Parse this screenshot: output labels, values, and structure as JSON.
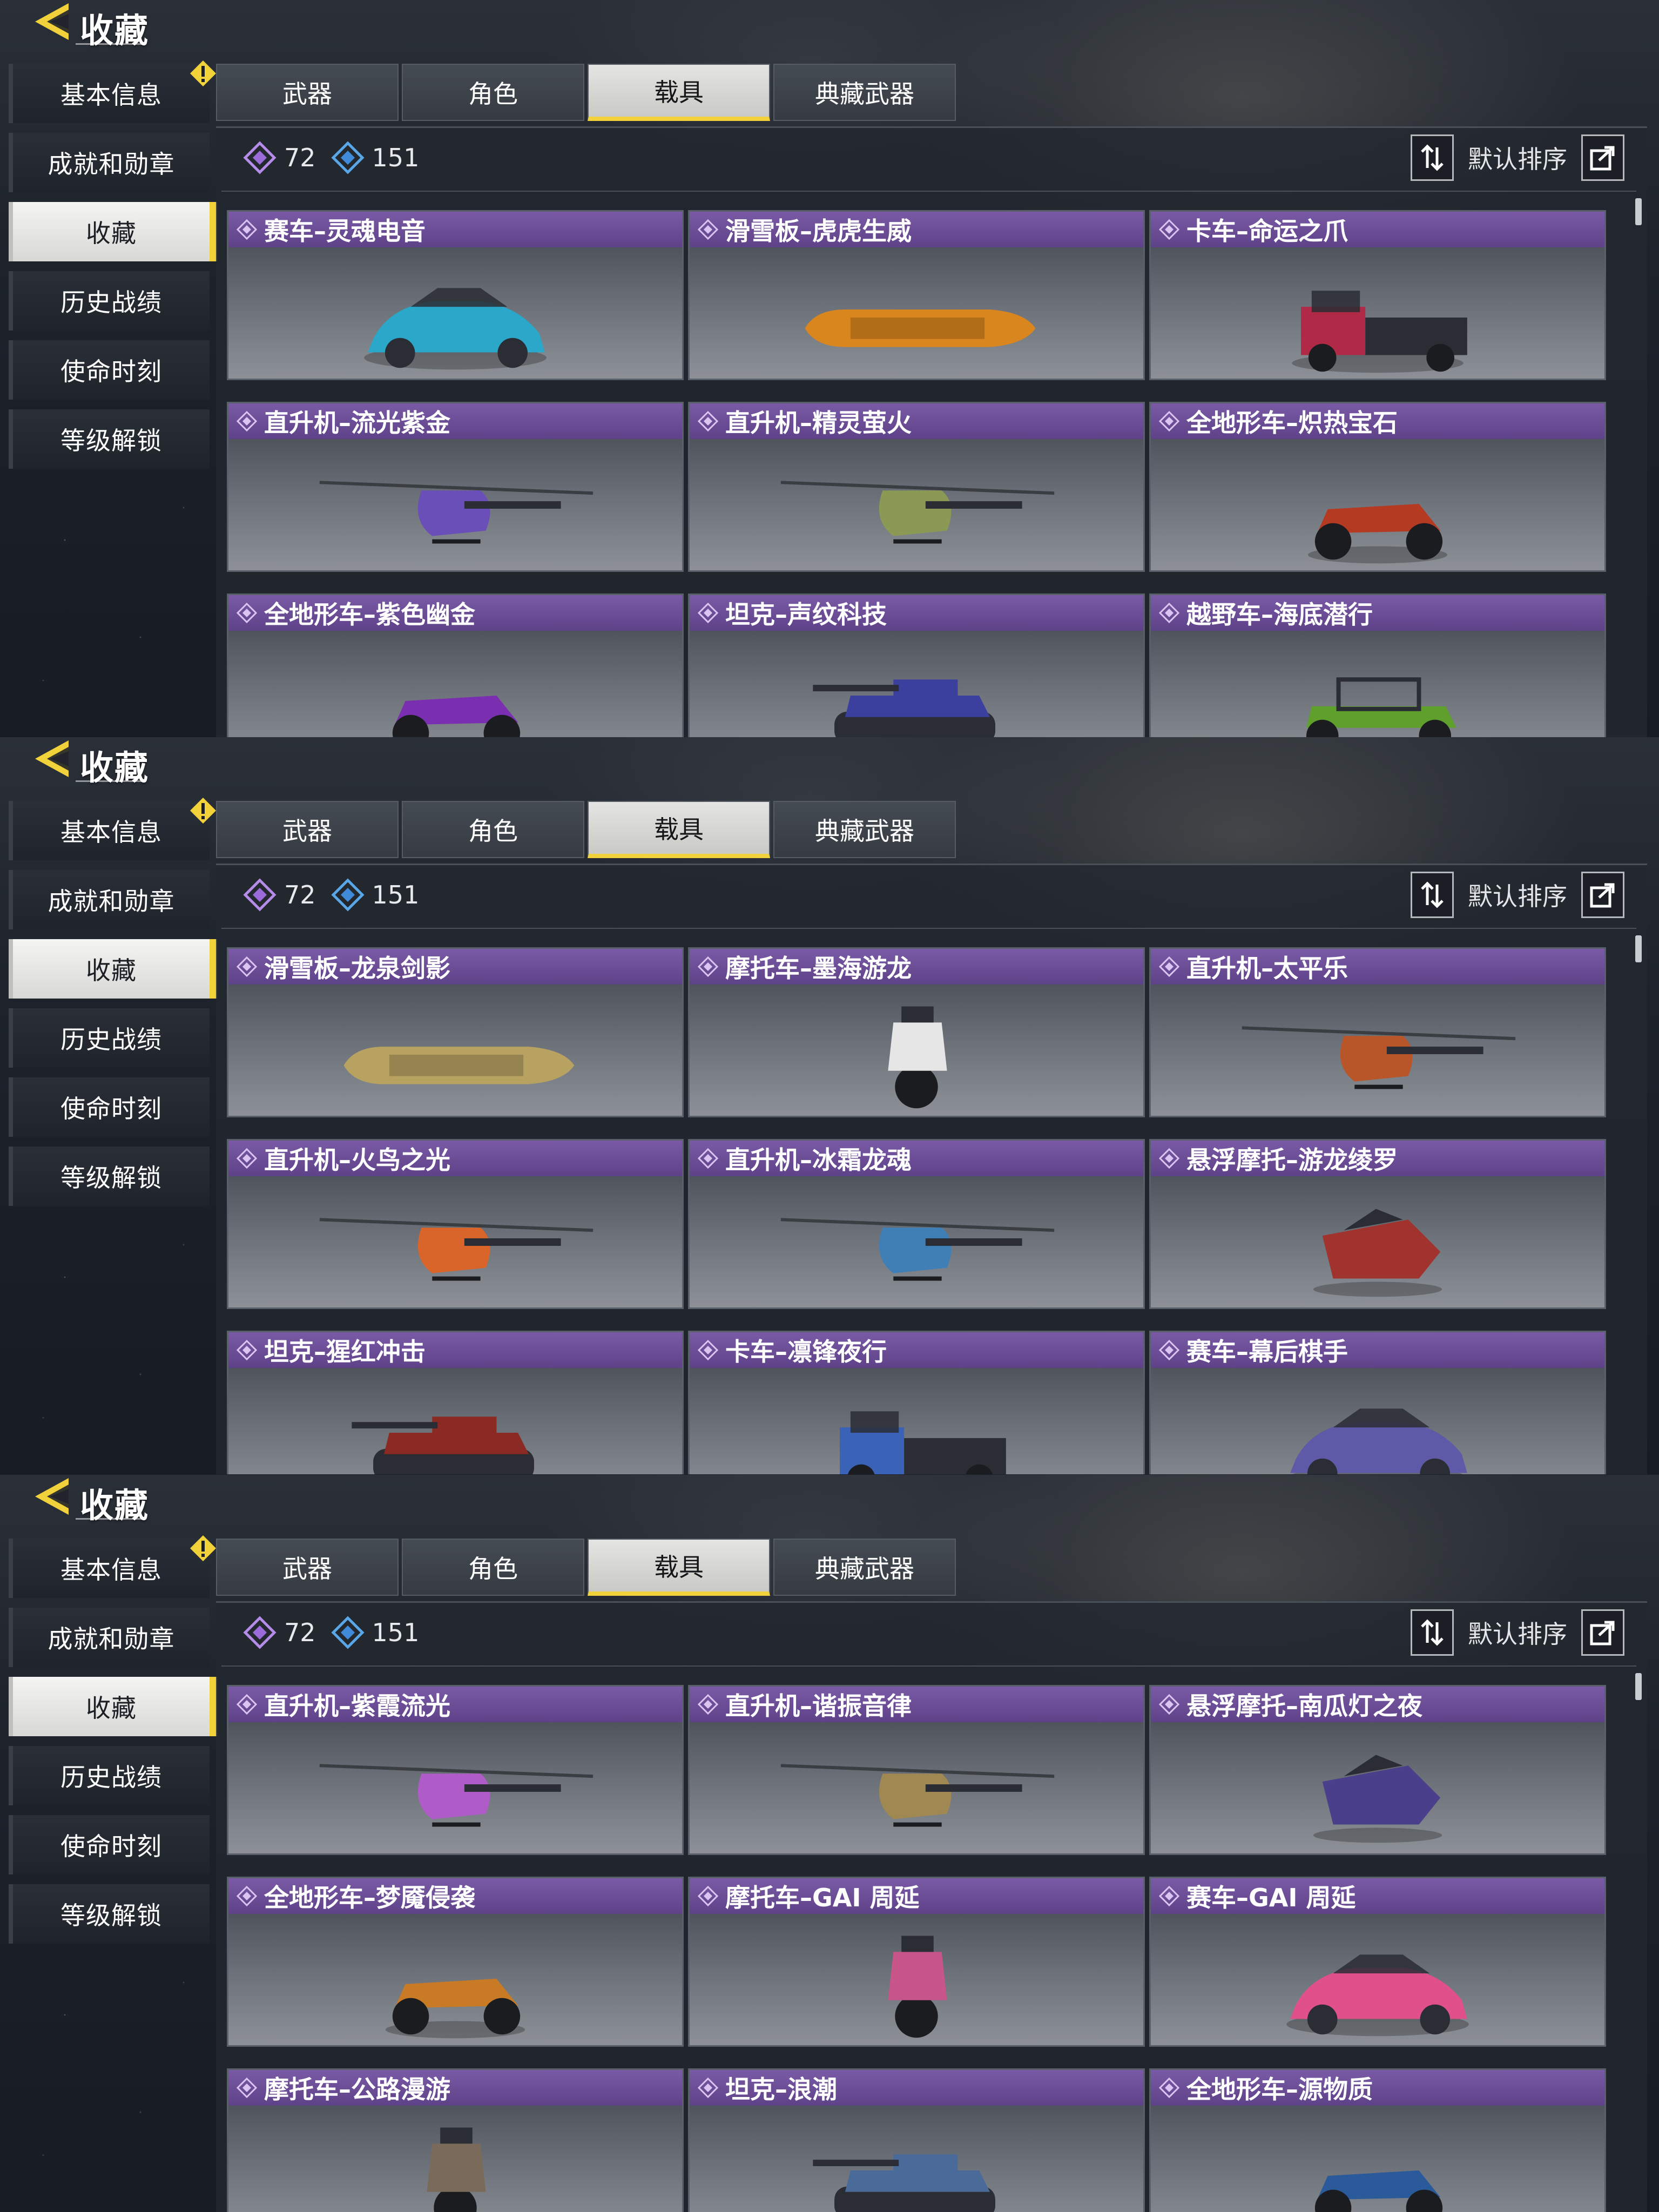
{
  "screens": [
    {
      "header": {
        "title": "收藏"
      },
      "sidebar": {
        "items": [
          {
            "label": "基本信息",
            "active": false,
            "alert": true
          },
          {
            "label": "成就和勋章",
            "active": false
          },
          {
            "label": "收藏",
            "active": true
          },
          {
            "label": "历史战绩",
            "active": false
          },
          {
            "label": "使命时刻",
            "active": false
          },
          {
            "label": "等级解锁",
            "active": false
          }
        ]
      },
      "tabs": [
        {
          "label": "武器",
          "active": false
        },
        {
          "label": "角色",
          "active": false
        },
        {
          "label": "载具",
          "active": true
        },
        {
          "label": "典藏武器",
          "active": false
        }
      ],
      "stats": {
        "purple_count": "72",
        "blue_count": "151"
      },
      "sort": {
        "label": "默认排序"
      },
      "cards": [
        {
          "title": "赛车–灵魂电音",
          "vehicle": "race-car",
          "color": "#2aa7c9"
        },
        {
          "title": "滑雪板–虎虎生威",
          "vehicle": "snowboard",
          "color": "#d9861f"
        },
        {
          "title": "卡车–命运之爪",
          "vehicle": "truck",
          "color": "#b02a48"
        },
        {
          "title": "直升机–流光紫金",
          "vehicle": "helicopter",
          "color": "#6a4fb8"
        },
        {
          "title": "直升机–精灵萤火",
          "vehicle": "helicopter",
          "color": "#8a9a55"
        },
        {
          "title": "全地形车–炽热宝石",
          "vehicle": "atv",
          "color": "#b53a22"
        },
        {
          "title": "全地形车–紫色幽金",
          "vehicle": "atv",
          "color": "#7a2fb0"
        },
        {
          "title": "坦克–声纹科技",
          "vehicle": "tank",
          "color": "#3b3f9e"
        },
        {
          "title": "越野车–海底潜行",
          "vehicle": "buggy",
          "color": "#5fa02c"
        }
      ]
    },
    {
      "header": {
        "title": "收藏"
      },
      "sidebar": {
        "items": [
          {
            "label": "基本信息",
            "active": false,
            "alert": true
          },
          {
            "label": "成就和勋章",
            "active": false
          },
          {
            "label": "收藏",
            "active": true
          },
          {
            "label": "历史战绩",
            "active": false
          },
          {
            "label": "使命时刻",
            "active": false
          },
          {
            "label": "等级解锁",
            "active": false
          }
        ]
      },
      "tabs": [
        {
          "label": "武器",
          "active": false
        },
        {
          "label": "角色",
          "active": false
        },
        {
          "label": "载具",
          "active": true
        },
        {
          "label": "典藏武器",
          "active": false
        }
      ],
      "stats": {
        "purple_count": "72",
        "blue_count": "151"
      },
      "sort": {
        "label": "默认排序"
      },
      "cards": [
        {
          "title": "滑雪板–龙泉剑影",
          "vehicle": "snowboard",
          "color": "#b8a262"
        },
        {
          "title": "摩托车–墨海游龙",
          "vehicle": "motorcycle",
          "color": "#e6e6e6"
        },
        {
          "title": "直升机–太平乐",
          "vehicle": "helicopter",
          "color": "#b8562a"
        },
        {
          "title": "直升机–火鸟之光",
          "vehicle": "helicopter",
          "color": "#d9652a"
        },
        {
          "title": "直升机–冰霜龙魂",
          "vehicle": "helicopter",
          "color": "#3f7fb5"
        },
        {
          "title": "悬浮摩托–游龙绫罗",
          "vehicle": "hoverbike",
          "color": "#a0332e"
        },
        {
          "title": "坦克–猩红冲击",
          "vehicle": "tank",
          "color": "#8a2a22"
        },
        {
          "title": "卡车–凛锋夜行",
          "vehicle": "truck",
          "color": "#3a63b8",
          "emblem": true
        },
        {
          "title": "赛车–幕后棋手",
          "vehicle": "race-car",
          "color": "#5e5aa8",
          "emblem": true
        }
      ]
    },
    {
      "header": {
        "title": "收藏"
      },
      "sidebar": {
        "items": [
          {
            "label": "基本信息",
            "active": false,
            "alert": true
          },
          {
            "label": "成就和勋章",
            "active": false
          },
          {
            "label": "收藏",
            "active": true
          },
          {
            "label": "历史战绩",
            "active": false
          },
          {
            "label": "使命时刻",
            "active": false
          },
          {
            "label": "等级解锁",
            "active": false
          }
        ]
      },
      "tabs": [
        {
          "label": "武器",
          "active": false
        },
        {
          "label": "角色",
          "active": false
        },
        {
          "label": "载具",
          "active": true
        },
        {
          "label": "典藏武器",
          "active": false
        }
      ],
      "stats": {
        "purple_count": "72",
        "blue_count": "151"
      },
      "sort": {
        "label": "默认排序"
      },
      "cards": [
        {
          "title": "直升机–紫霞流光",
          "vehicle": "helicopter",
          "color": "#b05cc8"
        },
        {
          "title": "直升机–谐振音律",
          "vehicle": "helicopter",
          "color": "#a08852"
        },
        {
          "title": "悬浮摩托–南瓜灯之夜",
          "vehicle": "hoverbike",
          "color": "#4a3f8a"
        },
        {
          "title": "全地形车–梦魇侵袭",
          "vehicle": "atv",
          "color": "#c87a25"
        },
        {
          "title": "摩托车–GAI 周延",
          "vehicle": "motorcycle",
          "color": "#c8558a"
        },
        {
          "title": "赛车–GAI 周延",
          "vehicle": "race-car",
          "color": "#e0508a"
        },
        {
          "title": "摩托车–公路漫游",
          "vehicle": "motorcycle",
          "color": "#7a6a5a"
        },
        {
          "title": "坦克–浪潮",
          "vehicle": "tank",
          "color": "#4a6a9a"
        },
        {
          "title": "全地形车–源物质",
          "vehicle": "atv",
          "color": "#2a5a9a"
        }
      ]
    }
  ]
}
